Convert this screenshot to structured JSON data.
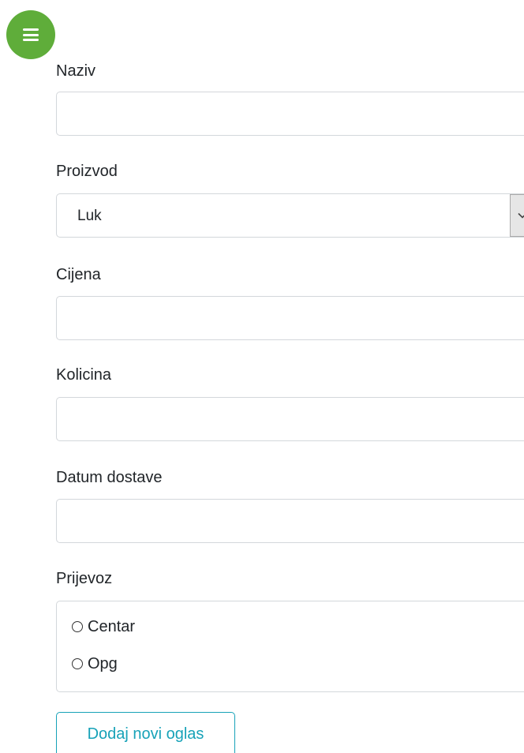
{
  "menu": {
    "icon": "hamburger-menu-icon",
    "color": "#5fad3a"
  },
  "form": {
    "naziv": {
      "label": "Naziv",
      "value": ""
    },
    "proizvod": {
      "label": "Proizvod",
      "selected": "Luk",
      "icon": "chevron-down-icon"
    },
    "cijena": {
      "label": "Cijena",
      "value": ""
    },
    "kolicina": {
      "label": "Kolicina",
      "value": ""
    },
    "datum_dostave": {
      "label": "Datum dostave",
      "value": ""
    },
    "prijevoz": {
      "label": "Prijevoz",
      "options": [
        {
          "label": "Centar",
          "checked": false
        },
        {
          "label": "Opg",
          "checked": false
        }
      ]
    },
    "submit_label": "Dodaj novi oglas",
    "submit_color": "#17a2b8"
  }
}
